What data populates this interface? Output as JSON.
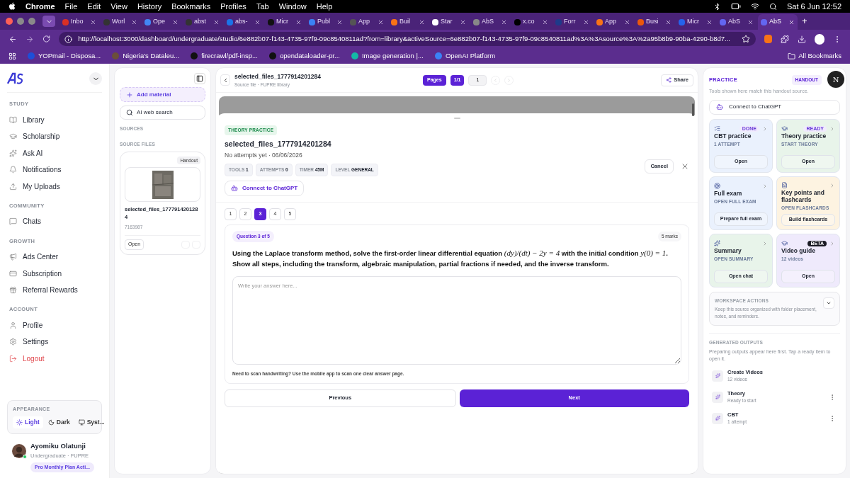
{
  "menu_bar": {
    "app": "Chrome",
    "items": [
      "File",
      "Edit",
      "View",
      "History",
      "Bookmarks",
      "Profiles",
      "Tab",
      "Window",
      "Help"
    ],
    "clock": "Sat 6 Jun  12:52"
  },
  "browser": {
    "tabs": [
      {
        "title": "Inbo",
        "color": "#d93025",
        "selected": false
      },
      {
        "title": "Worl",
        "color": "#333333",
        "selected": false
      },
      {
        "title": "Ope",
        "color": "#4285f4",
        "selected": false
      },
      {
        "title": "abst",
        "color": "#333333",
        "selected": false
      },
      {
        "title": "abs-",
        "color": "#1a73e8",
        "selected": false
      },
      {
        "title": "Micr",
        "color": "#111111",
        "selected": false
      },
      {
        "title": "Publ",
        "color": "#3b82f6",
        "selected": false
      },
      {
        "title": "App",
        "color": "#555555",
        "selected": false
      },
      {
        "title": "Buil",
        "color": "#f97316",
        "selected": false
      },
      {
        "title": "Star",
        "color": "#ffffff",
        "selected": false
      },
      {
        "title": "AbS",
        "color": "#888888",
        "selected": false
      },
      {
        "title": "x.co",
        "color": "#000000",
        "selected": false
      },
      {
        "title": "Forr",
        "color": "#1e3a8a",
        "selected": false
      },
      {
        "title": "App",
        "color": "#f97316",
        "selected": false
      },
      {
        "title": "Busi",
        "color": "#ea580c",
        "selected": false
      },
      {
        "title": "Micr",
        "color": "#2563eb",
        "selected": false
      },
      {
        "title": "AbS",
        "color": "#6366f1",
        "selected": false
      },
      {
        "title": "AbS",
        "color": "#6366f1",
        "selected": true
      }
    ],
    "new_tab": "+",
    "url": "http://localhost:3000/dashboard/undergraduate/studio/6e882b07-f143-4735-97f9-09c8540811ad?from=library&activeSource=6e882b07-f143-4735-97f9-09c8540811ad%3A%3Asource%3A%2a95b8b9-90ba-4290-b8d7...",
    "bookmarks": [
      {
        "title": "YOPmail - Disposa...",
        "color": "#1d4ed8"
      },
      {
        "title": "Nigeria's Dataleu...",
        "color": "#6b4f3a"
      },
      {
        "title": "firecrawl/pdf-insp...",
        "color": "#111111"
      },
      {
        "title": "opendataloader-pr...",
        "color": "#111111"
      },
      {
        "title": "Image generation |...",
        "color": "#14b8a6"
      },
      {
        "title": "OpenAI Platform",
        "color": "#3b82f6"
      }
    ],
    "all_bookmarks": "All Bookmarks"
  },
  "sidebar": {
    "sections": [
      {
        "title": "STUDY",
        "items": [
          {
            "label": "Library",
            "danger": false
          },
          {
            "label": "Scholarship",
            "danger": false
          },
          {
            "label": "Ask AI",
            "danger": false
          },
          {
            "label": "Notifications",
            "danger": false
          },
          {
            "label": "My Uploads",
            "danger": false
          }
        ]
      },
      {
        "title": "COMMUNITY",
        "items": [
          {
            "label": "Chats",
            "danger": false
          }
        ]
      },
      {
        "title": "GROWTH",
        "items": [
          {
            "label": "Ads Center",
            "danger": false
          },
          {
            "label": "Subscription",
            "danger": false
          },
          {
            "label": "Referral Rewards",
            "danger": false
          }
        ]
      },
      {
        "title": "ACCOUNT",
        "items": [
          {
            "label": "Profile",
            "danger": false
          },
          {
            "label": "Settings",
            "danger": false
          },
          {
            "label": "Logout",
            "danger": true
          }
        ]
      }
    ],
    "appearance": {
      "title": "APPEARANCE",
      "options": [
        {
          "label": "Light",
          "selected": true
        },
        {
          "label": "Dark",
          "selected": false
        },
        {
          "label": "Syst...",
          "selected": false
        }
      ]
    },
    "user": {
      "name": "Ayomiku Olatunji",
      "role": "Undergraduate · FUPRE",
      "plan": "Pro Monthly Plan Acti...",
      "online": true
    }
  },
  "sources_panel": {
    "add": "Add material",
    "search": "AI web search",
    "sources_label": "SOURCES",
    "files_label": "SOURCE FILES",
    "file": {
      "tag": "Handout",
      "name": "selected_files_1777914201284",
      "id": "7163987",
      "open": "Open"
    }
  },
  "viewer": {
    "title": "selected_files_1777914201284",
    "subtitle": "Source file · FUPRE library",
    "pages_label": "Pages",
    "page_count": "1/1",
    "page": "1",
    "share": "Share"
  },
  "practice_sheet": {
    "tag": "THEORY PRACTICE",
    "title": "selected_files_1777914201284",
    "meta": "No attempts yet · 06/06/2026",
    "chips": [
      {
        "label": "TOOLS",
        "value": "1"
      },
      {
        "label": "ATTEMPTS",
        "value": "0"
      },
      {
        "label": "TIMER",
        "value": "45M"
      },
      {
        "label": "LEVEL",
        "value": "GENERAL"
      }
    ],
    "connect": "Connect to ChatGPT",
    "cancel": "Cancel",
    "questions": [
      {
        "label": "1",
        "selected": false
      },
      {
        "label": "2",
        "selected": false
      },
      {
        "label": "3",
        "selected": true
      },
      {
        "label": "4",
        "selected": false
      },
      {
        "label": "5",
        "selected": false
      }
    ],
    "question": {
      "badge": "Question 3 of 5",
      "marks": "5 marks",
      "segments": [
        {
          "kind": "text",
          "text": "Using the Laplace transform method, solve the first-order linear differential equation "
        },
        {
          "kind": "math",
          "text": "(dy)/(dt) − 2y = 4"
        },
        {
          "kind": "text",
          "text": " with the initial condition "
        },
        {
          "kind": "math",
          "text": "y(0) = 1"
        },
        {
          "kind": "text",
          "text": ". Show all steps, including the transform, algebraic manipulation, partial fractions if needed, and the inverse transform."
        }
      ],
      "placeholder": "Write your answer here...",
      "note": "Need to scan handwriting? Use the mobile app to scan one clear answer page."
    },
    "previous": "Previous",
    "next": "Next"
  },
  "practice_panel": {
    "title": "PRACTICE",
    "source_badge": "HANDOUT",
    "avatar": "N",
    "hint": "Tools shown here match this handout source.",
    "connect": "Connect to ChatGPT",
    "card_rows": [
      {
        "cards": [
          {
            "title": "CBT practice",
            "subtitle": "1 ATTEMPT",
            "action": "Open",
            "color": "#eaf1fd",
            "badge": {
              "kind": "soft",
              "text": "DONE"
            }
          },
          {
            "title": "Theory practice",
            "subtitle": "START THEORY",
            "action": "Open",
            "color": "#e8f4ea",
            "badge": {
              "kind": "soft",
              "text": "READY"
            }
          }
        ]
      },
      {
        "cards": [
          {
            "title": "Full exam",
            "subtitle": "OPEN FULL EXAM",
            "action": "Prepare full exam",
            "color": "#eaf1fd"
          },
          {
            "title": "Key points and flashcards",
            "subtitle": "OPEN FLASHCARDS",
            "action": "Build flashcards",
            "color": "#fdf3e1"
          }
        ]
      },
      {
        "cards": [
          {
            "title": "Summary",
            "subtitle": "OPEN SUMMARY",
            "action": "Open chat",
            "color": "#e8f4ea"
          },
          {
            "title": "Video guide",
            "subtitle": "12 videos",
            "action": "Open",
            "color": "#efeafc",
            "badge": {
              "kind": "dark",
              "text": "BETA"
            }
          }
        ]
      }
    ],
    "workspace": {
      "title": "WORKSPACE ACTIONS",
      "text": "Keep this source organized with folder placement, notes, and reminders."
    },
    "outputs": {
      "title": "GENERATED OUTPUTS",
      "text": "Preparing outputs appear here first. Tap a ready item to open it.",
      "items": [
        {
          "title": "Create Videos",
          "subtitle": "12 videos",
          "menu": false
        },
        {
          "title": "Theory",
          "subtitle": "Ready to start",
          "menu": true
        },
        {
          "title": "CBT",
          "subtitle": "1 attempt",
          "menu": true
        }
      ]
    }
  }
}
